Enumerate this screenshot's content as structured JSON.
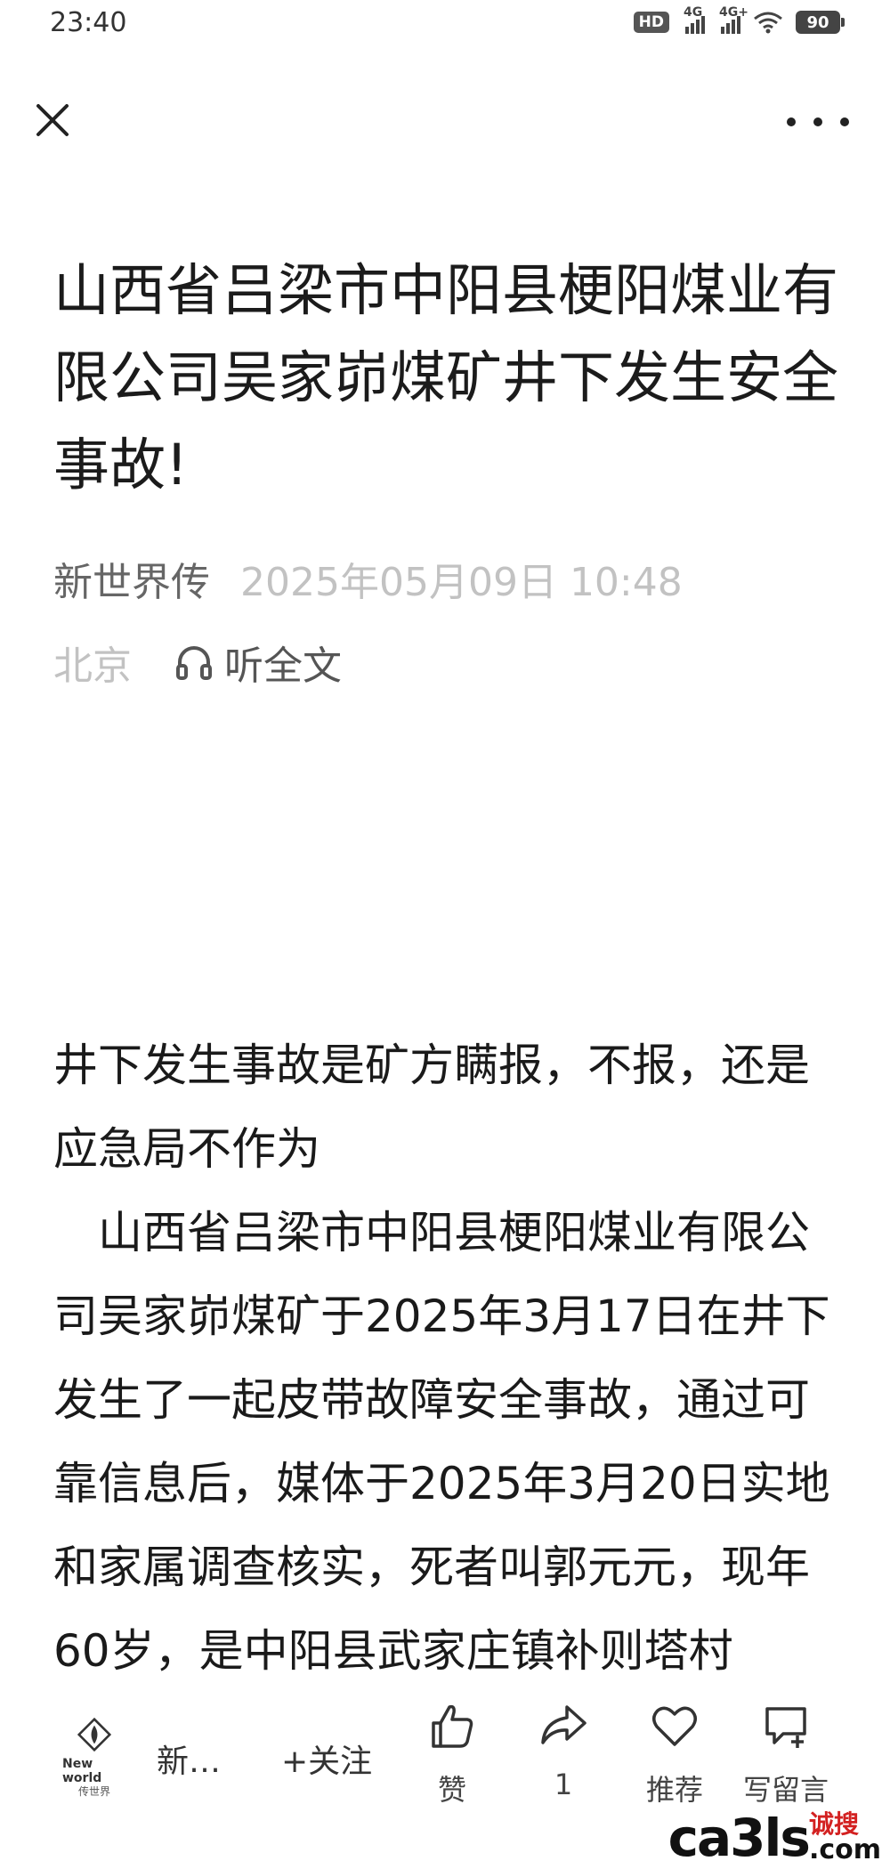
{
  "status_bar": {
    "time": "23:40",
    "hd_label": "HD",
    "signal1_label": "4G",
    "signal2_label": "4G+",
    "battery": "90"
  },
  "nav": {
    "close_icon": "close-icon",
    "more_icon": "more-icon"
  },
  "article": {
    "title": "山西省吕梁市中阳县梗阳煤业有限公司吴家峁煤矿井下发生安全事故!",
    "author": "新世界传",
    "date": "2025年05月09日 10:48",
    "location": "北京",
    "listen_label": "听全文",
    "paragraphs": [
      "井下发生事故是矿方瞒报，不报，还是应急局不作为",
      "山西省吕梁市中阳县梗阳煤业有限公司吴家峁煤矿于2025年3月17日在井下发生了一起皮带故障安全事故，通过可靠信息后，媒体于2025年3月20日实地和家属调查核实，死者叫郭元元，现年60岁，是中阳县武家庄镇补则塔村"
    ]
  },
  "bottom_bar": {
    "account_name": "新…",
    "follow_label": "+关注",
    "like_label": "赞",
    "share_count": "1",
    "recommend_label": "推荐",
    "comment_label": "写留言",
    "logo_text_top": "New world",
    "logo_text_bottom": "传世界"
  },
  "watermark": {
    "main": "ca3ls",
    "red_text": "诚搜",
    "suffix": ".com"
  },
  "colors": {
    "text_primary": "#1a1a1a",
    "text_meta": "#c2c2c2",
    "author": "#666666",
    "watermark_red": "#d32121"
  }
}
